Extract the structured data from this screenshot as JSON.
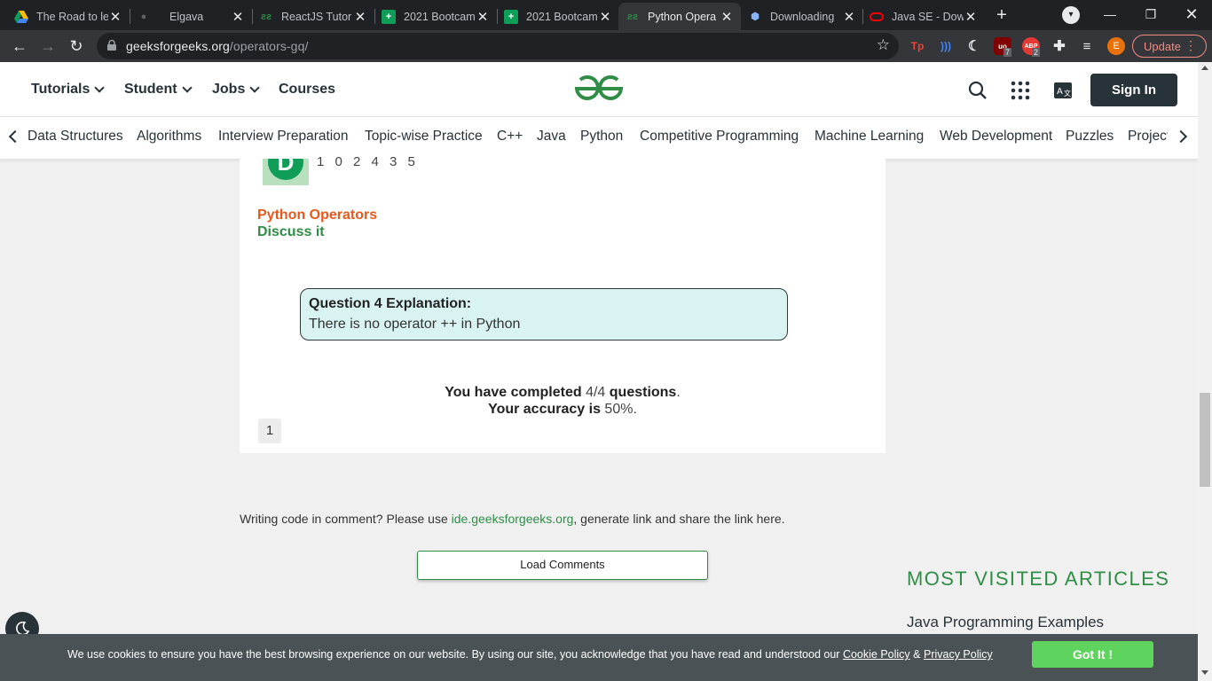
{
  "browser": {
    "tabs": [
      {
        "title": "The Road to le",
        "favicon": "drive-icon",
        "active": false
      },
      {
        "title": "Elgava",
        "favicon": "github-icon",
        "active": false
      },
      {
        "title": "ReactJS Tutor",
        "favicon": "gfg-icon",
        "active": false
      },
      {
        "title": "2021 Bootcam",
        "favicon": "sheets-icon",
        "active": false
      },
      {
        "title": "2021 Bootcam",
        "favicon": "sheets-icon",
        "active": false
      },
      {
        "title": "Python Opera",
        "favicon": "gfg-icon",
        "active": true
      },
      {
        "title": "Downloading",
        "favicon": "extension-icon",
        "active": false
      },
      {
        "title": "Java SE - Dow",
        "favicon": "oracle-icon",
        "active": false
      }
    ],
    "url_host": "geeksforgeeks.org",
    "url_path": "/operators-gq/",
    "extensions": [
      {
        "name": "ublock-icon",
        "badge": "7"
      },
      {
        "name": "adblock-icon",
        "badge": "2"
      }
    ],
    "avatar_letter": "E",
    "update_label": "Update"
  },
  "header": {
    "menus": [
      "Tutorials",
      "Student",
      "Jobs"
    ],
    "courses_label": "Courses",
    "signin_label": "Sign In"
  },
  "subnav": {
    "items": [
      "Data Structures",
      "Algorithms",
      "Interview Preparation",
      "Topic-wise Practice",
      "C++",
      "Java",
      "Python",
      "Competitive Programming",
      "Machine Learning",
      "Web Development",
      "Puzzles",
      "Project Idea"
    ]
  },
  "quiz": {
    "avatar_letter": "D",
    "code_snippet": "1 0 2 4 3 5",
    "tag_label": "Python Operators",
    "discuss_label": "Discuss it",
    "explanation_heading": "Question 4 Explanation:",
    "explanation_body": "There is no operator ++ in Python",
    "completed_prefix": "You have completed",
    "completed_value": "4/4",
    "completed_suffix": "questions",
    "accuracy_prefix": "Your accuracy is",
    "accuracy_value": "50%",
    "page_number": "1"
  },
  "comments": {
    "note_prefix": "Writing code in comment? Please use",
    "note_link": "ide.geeksforgeeks.org",
    "note_suffix": ", generate link and share the link here.",
    "load_label": "Load Comments"
  },
  "sidebar": {
    "most_visited_heading": "MOST VISITED ARTICLES",
    "first_article": "Java Programming Examples"
  },
  "cookie_banner": {
    "message": "We use cookies to ensure you have the best browsing experience on our website. By using our site, you acknowledge that you have read and understood our",
    "cookie_policy": "Cookie Policy",
    "amp": "&",
    "privacy_policy": "Privacy Policy",
    "button_label": "Got It !"
  },
  "colors": {
    "gfg_green": "#2f8d46",
    "header_dark": "#273239",
    "tag_orange": "#e8581c",
    "explain_bg": "#d9f2f2",
    "cookie_bg": "#4a5256",
    "gotit_green": "#5ed45e"
  }
}
